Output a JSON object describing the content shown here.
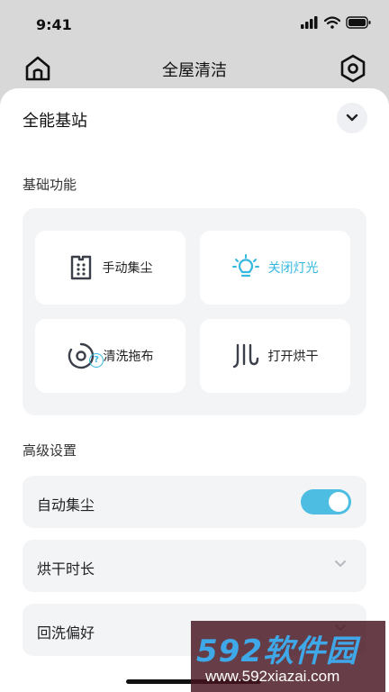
{
  "status_bar": {
    "time": "9:41"
  },
  "header": {
    "title": "全屋清洁"
  },
  "sheet": {
    "title": "全能基站",
    "basic_section": {
      "label": "基础功能",
      "buttons": [
        {
          "label": "手动集尘",
          "icon": "dust-bin-icon",
          "active": false
        },
        {
          "label": "关闭灯光",
          "icon": "light-bulb-icon",
          "active": true
        },
        {
          "label": "清洗拖布",
          "icon": "mop-wash-icon",
          "active": false
        },
        {
          "label": "打开烘干",
          "icon": "dry-heat-icon",
          "active": false
        }
      ]
    },
    "advanced_section": {
      "label": "高级设置",
      "help_symbol": "?",
      "rows": [
        {
          "label": "自动集尘",
          "control": "toggle",
          "on": true
        },
        {
          "label": "烘干时长",
          "control": "dropdown"
        },
        {
          "label": "回洗偏好",
          "control": "dropdown"
        }
      ]
    }
  },
  "watermark": {
    "brand": "592软件园",
    "url": "www.592xiazai.com"
  },
  "colors": {
    "accent": "#35b8e0",
    "toggle_on": "#4dbde2",
    "panel": "#f3f4f6",
    "backdrop": "#d8d8d8"
  }
}
